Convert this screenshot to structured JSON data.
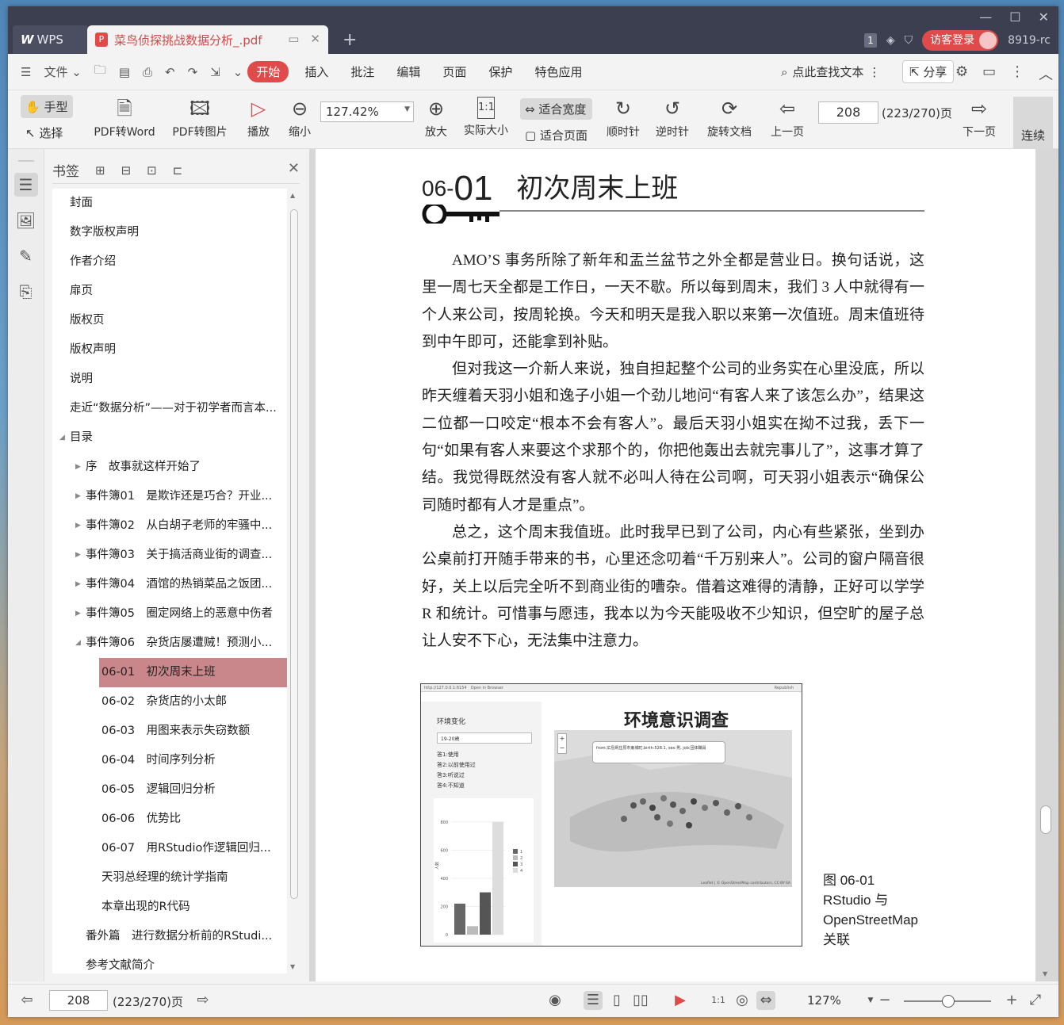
{
  "titlebar": {
    "app_tab": "WPS",
    "doc_tab": "菜鸟侦探挑战数据分析_.pdf",
    "page_count_badge": "1",
    "login": "访客登录",
    "version": "8919-rc"
  },
  "menu": {
    "file": "文件",
    "items": [
      "开始",
      "插入",
      "批注",
      "编辑",
      "页面",
      "保护",
      "特色应用"
    ],
    "search": "点此查找文本",
    "share": "分享"
  },
  "toolbar": {
    "hand": "手型",
    "select": "选择",
    "pdf_to_word": "PDF转Word",
    "pdf_to_image": "PDF转图片",
    "play": "播放",
    "zoom_out": "缩小",
    "zoom_value": "127.42%",
    "zoom_in": "放大",
    "actual_size": "实际大小",
    "fit_width": "适合宽度",
    "fit_page": "适合页面",
    "clockwise": "顺时针",
    "counter_clockwise": "逆时针",
    "rotate_doc": "旋转文档",
    "prev_page": "上一页",
    "page": "208",
    "page_total": "(223/270)页",
    "next_page": "下一页",
    "continuous": "连续"
  },
  "sidebar": {
    "title": "书签",
    "bookmarks": [
      {
        "label": "封面",
        "level": 0,
        "toggle": ""
      },
      {
        "label": "数字版权声明",
        "level": 0,
        "toggle": ""
      },
      {
        "label": "作者介绍",
        "level": 0,
        "toggle": ""
      },
      {
        "label": "扉页",
        "level": 0,
        "toggle": ""
      },
      {
        "label": "版权页",
        "level": 0,
        "toggle": ""
      },
      {
        "label": "版权声明",
        "level": 0,
        "toggle": ""
      },
      {
        "label": "说明",
        "level": 0,
        "toggle": ""
      },
      {
        "label": "走近“数据分析”——对于初学者而言本...",
        "level": 0,
        "toggle": ""
      },
      {
        "label": "目录",
        "level": 0,
        "toggle": "open"
      },
      {
        "label": "序　故事就这样开始了",
        "level": 1,
        "toggle": "closed"
      },
      {
        "label": "事件簿01　是欺诈还是巧合？开业...",
        "level": 1,
        "toggle": "closed"
      },
      {
        "label": "事件簿02　从白胡子老师的牢骚中...",
        "level": 1,
        "toggle": "closed"
      },
      {
        "label": "事件簿03　关于搞活商业街的调查...",
        "level": 1,
        "toggle": "closed"
      },
      {
        "label": "事件簿04　酒馆的热销菜品之饭团...",
        "level": 1,
        "toggle": "closed"
      },
      {
        "label": "事件簿05　圈定网络上的恶意中伤者",
        "level": 1,
        "toggle": "closed"
      },
      {
        "label": "事件簿06　杂货店屡遭贼！预测小...",
        "level": 1,
        "toggle": "open"
      },
      {
        "label": "06-01　初次周末上班",
        "level": 2,
        "toggle": "",
        "selected": true
      },
      {
        "label": "06-02　杂货店的小太郎",
        "level": 2,
        "toggle": ""
      },
      {
        "label": "06-03　用图来表示失窃数额",
        "level": 2,
        "toggle": ""
      },
      {
        "label": "06-04　时间序列分析",
        "level": 2,
        "toggle": ""
      },
      {
        "label": "06-05　逻辑回归分析",
        "level": 2,
        "toggle": ""
      },
      {
        "label": "06-06　优势比",
        "level": 2,
        "toggle": ""
      },
      {
        "label": "06-07　用RStudio作逻辑回归...",
        "level": 2,
        "toggle": ""
      },
      {
        "label": "天羽总经理的统计学指南",
        "level": 2,
        "toggle": ""
      },
      {
        "label": "本章出现的R代码",
        "level": 2,
        "toggle": ""
      },
      {
        "label": "番外篇　进行数据分析前的RStudi...",
        "level": 1,
        "toggle": ""
      },
      {
        "label": "参考文献简介",
        "level": 1,
        "toggle": ""
      }
    ]
  },
  "document": {
    "section_number_small": "06-",
    "section_number_big": "01",
    "section_title": "初次周末上班",
    "paragraphs": [
      "AMO’S 事务所除了新年和盂兰盆节之外全都是营业日。换句话说，这里一周七天全都是工作日，一天不歇。所以每到周末，我们 3 人中就得有一个人来公司，按周轮换。今天和明天是我入职以来第一次值班。周末值班待到中午即可，还能拿到补贴。",
      "但对我这一介新人来说，独自担起整个公司的业务实在心里没底，所以昨天缠着天羽小姐和逸子小姐一个劲儿地问“有客人来了该怎么办”，结果这二位都一口咬定“根本不会有客人”。最后天羽小姐实在拗不过我，丢下一句“如果有客人来要这个求那个的，你把他轰出去就完事儿了”，这事才算了结。我觉得既然没有客人就不必叫人待在公司啊，可天羽小姐表示“确保公司随时都有人才是重点”。",
      "总之，这个周末我值班。此时我早已到了公司，内心有些紧张，坐到办公桌前打开随手带来的书，心里还念叨着“千万别来人”。公司的窗户隔音很好，关上以后完全听不到商业街的嘈杂。借着这难得的清静，正好可以学学 R 和统计。可惜事与愿违，我本以为今天能吸收不少知识，但空旷的屋子总让人安不下心，无法集中注意力。"
    ],
    "figure": {
      "url_bar": "http://127.0.0.1:6154　Open in Browser",
      "republish": "Republish",
      "panel_title": "环境变化",
      "select_value": "19-20歳",
      "options": [
        "答1:使用",
        "答2:以前使用过",
        "答3:听说过",
        "答4:不知道"
      ],
      "chart_title": "环境意识调查",
      "popup": "from:広島県庄原市東城町,birth:528.1, sex:男, job:団体職員",
      "attribution": "Leaflet | © OpenStreetMap contributors, CC-BY-SA",
      "y_ticks": [
        "800",
        "600",
        "400",
        "200",
        "0"
      ],
      "y_label": "人数",
      "legend": [
        "1",
        "2",
        "3",
        "4"
      ],
      "bar_values": [
        220,
        60,
        300,
        800
      ]
    },
    "caption_lines": [
      "图 06-01",
      "RStudio 与",
      "OpenStreetMap",
      "关联"
    ]
  },
  "statusbar": {
    "page": "208",
    "page_total": "(223/270)页",
    "zoom": "127%"
  }
}
